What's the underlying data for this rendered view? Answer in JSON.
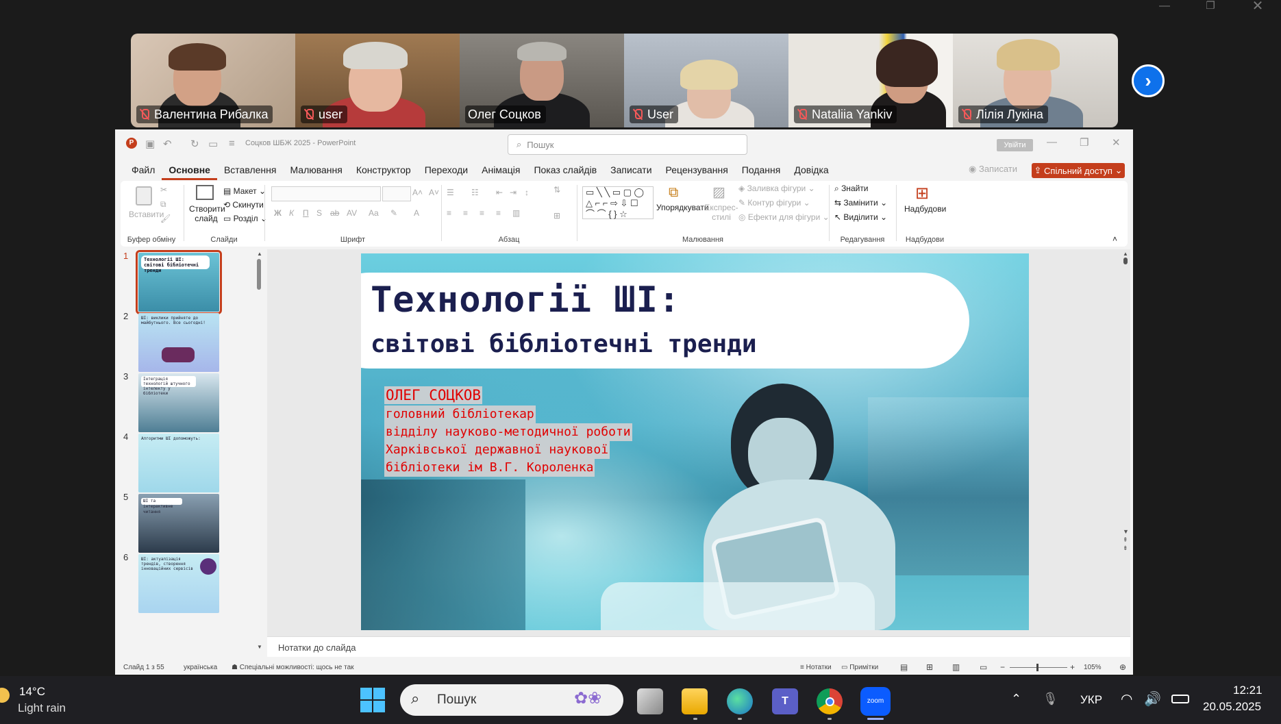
{
  "participants": [
    {
      "name": "Валентина Рибалка",
      "muted": true
    },
    {
      "name": "user",
      "muted": true
    },
    {
      "name": "Олег Соцков",
      "muted": false,
      "active": true
    },
    {
      "name": "User",
      "muted": true
    },
    {
      "name": "Nataliia Yankiv",
      "muted": true
    },
    {
      "name": "Лілія Лукіна",
      "muted": true
    }
  ],
  "ppt": {
    "doc_title": "Соцков ШБЖ 2025",
    "app_name": "PowerPoint",
    "search_placeholder": "Пошук",
    "signin": "Увійти",
    "record": "Записати",
    "share": "Спільний доступ",
    "menu": [
      "Файл",
      "Основне",
      "Вставлення",
      "Малювання",
      "Конструктор",
      "Переходи",
      "Анімація",
      "Показ слайдів",
      "Записати",
      "Рецензування",
      "Подання",
      "Довідка"
    ],
    "ribbon": {
      "paste": "Вставити",
      "clipboard_group": "Буфер обміну",
      "new_slide": "Створити слайд",
      "layout": "Макет",
      "reset": "Скинути",
      "section": "Розділ",
      "slides_group": "Слайди",
      "font_group": "Шрифт",
      "paragraph_group": "Абзац",
      "arrange": "Упорядкувати",
      "quick_styles": "Експрес-стилі",
      "fill": "Заливка фігури",
      "outline": "Контур фігури",
      "effects": "Ефекти для фігури",
      "drawing_group": "Малювання",
      "find": "Знайти",
      "replace": "Замінити",
      "select": "Виділити",
      "editing_group": "Редагування",
      "addins": "Надбудови",
      "addins_group": "Надбудови"
    },
    "slide": {
      "title_line1": "Технології ШІ:",
      "title_line2": "світові бібліотечні тренди",
      "author_lines": [
        "ОЛЕГ СОЦКОВ",
        "головний бібліотекар",
        "відділу науково-методичної роботи",
        "Харківської державної наукової",
        "бібліотеки ім В.Г. Короленка"
      ]
    },
    "thumbnails": [
      {
        "num": "1",
        "text": "Технології ШІ: світові бібліотечні тренди"
      },
      {
        "num": "2",
        "text": "ШІ: виклики прийняте до майбутнього. Все сьогодні!"
      },
      {
        "num": "3",
        "text": "Інтеграція технологій штучного інтелекту у бібліотеки"
      },
      {
        "num": "4",
        "text": "Алгоритми ШІ допоможуть:"
      },
      {
        "num": "5",
        "text": "ШІ та інтерактивне читання"
      },
      {
        "num": "6",
        "text": "ШІ: актуалізація трендів, створення інноваційних сервісів"
      }
    ],
    "notes_placeholder": "Нотатки до слайда",
    "status": {
      "slide_counter": "Слайд 1 з 55",
      "language": "українська",
      "accessibility": "Спеціальні можливості: щось не так",
      "notes_btn": "Нотатки",
      "comments_btn": "Примітки",
      "zoom": "105%"
    }
  },
  "taskbar": {
    "weather_temp": "14°C",
    "weather_desc": "Light rain",
    "search": "Пошук",
    "lang": "УКР",
    "time": "12:21",
    "date": "20.05.2025",
    "zoom_label": "zoom"
  }
}
